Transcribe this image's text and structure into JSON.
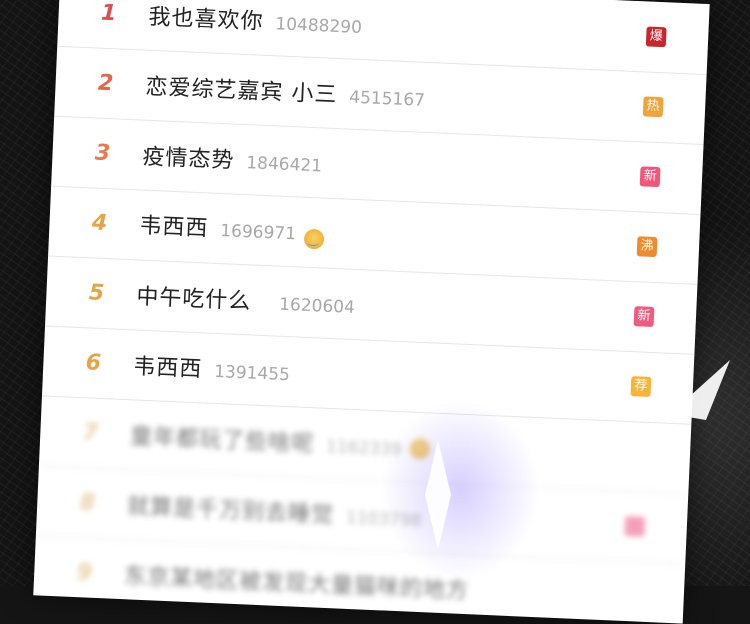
{
  "list": [
    {
      "rank": "1",
      "title": "我也喜欢你",
      "count": "10488290",
      "emoji": false,
      "badge": "爆",
      "rank_color": "#e14b4b",
      "badge_color": "#c9252d"
    },
    {
      "rank": "2",
      "title": "恋爱综艺嘉宾  小三",
      "count": "4515167",
      "emoji": false,
      "badge": "热",
      "rank_color": "#e8624a",
      "badge_color": "#f4a23a"
    },
    {
      "rank": "3",
      "title": "疫情态势",
      "count": "1846421",
      "emoji": false,
      "badge": "新",
      "rank_color": "#ea7a4b",
      "badge_color": "#f0577a"
    },
    {
      "rank": "4",
      "title": "韦西西",
      "count": "1696971",
      "emoji": true,
      "badge": "沸",
      "rank_color": "#e3a548",
      "badge_color": "#f08a2a"
    },
    {
      "rank": "5",
      "title": "中午吃什么",
      "count": "1620604",
      "emoji": false,
      "badge": "新",
      "rank_color": "#e3a548",
      "badge_color": "#ee5b7c"
    },
    {
      "rank": "6",
      "title": "韦西西",
      "count": "1391455",
      "emoji": false,
      "badge": "荐",
      "rank_color": "#e3a548",
      "badge_color": "#f5b53b"
    },
    {
      "rank": "7",
      "title": "童年都玩了些啥呢",
      "count": "1162339",
      "emoji": true,
      "badge": "",
      "rank_color": "#e3c48e",
      "badge_color": ""
    },
    {
      "rank": "8",
      "title": "就算是千万别去睡觉",
      "count": "1103798",
      "emoji": false,
      "badge": "",
      "rank_color": "#e3c48e",
      "badge_color": "#f08aa6"
    },
    {
      "rank": "9",
      "title": "东京某地区被发现大量猫咪的地方",
      "count": "",
      "emoji": false,
      "badge": "",
      "rank_color": "#e3c48e",
      "badge_color": ""
    }
  ]
}
